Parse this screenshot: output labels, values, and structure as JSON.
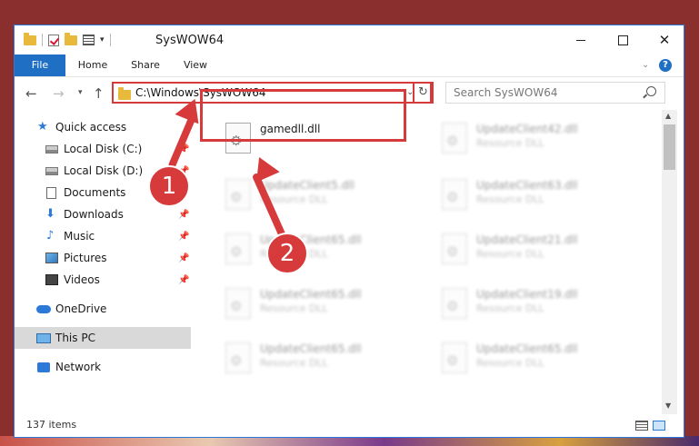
{
  "window": {
    "title": "SysWOW64"
  },
  "ribbon": {
    "tabs": [
      "File",
      "Home",
      "Share",
      "View"
    ]
  },
  "address": {
    "path": "C:\\Windows\\SysWOW64"
  },
  "search": {
    "placeholder": "Search SysWOW64"
  },
  "nav": {
    "items": [
      {
        "label": "Quick access",
        "icon": "star-icon",
        "pinned": false
      },
      {
        "label": "Local Disk (C:)",
        "icon": "drive-icon",
        "pinned": true
      },
      {
        "label": "Local Disk (D:)",
        "icon": "drive-icon",
        "pinned": true
      },
      {
        "label": "Documents",
        "icon": "documents-icon",
        "pinned": true
      },
      {
        "label": "Downloads",
        "icon": "download-icon",
        "pinned": true
      },
      {
        "label": "Music",
        "icon": "music-icon",
        "pinned": true
      },
      {
        "label": "Pictures",
        "icon": "pictures-icon",
        "pinned": true
      },
      {
        "label": "Videos",
        "icon": "videos-icon",
        "pinned": true
      },
      {
        "label": "OneDrive",
        "icon": "cloud-icon",
        "pinned": false
      },
      {
        "label": "This PC",
        "icon": "computer-icon",
        "pinned": false
      },
      {
        "label": "Network",
        "icon": "network-icon",
        "pinned": false
      }
    ]
  },
  "files": [
    {
      "name": "gamedll.dll",
      "type": ""
    },
    {
      "name": "UpdateClient42.dll",
      "type": "Resource DLL"
    },
    {
      "name": "UpdateClient5.dll",
      "type": "Resource DLL"
    },
    {
      "name": "UpdateClient63.dll",
      "type": "Resource DLL"
    },
    {
      "name": "UpdateClient65.dll",
      "type": "Resource DLL"
    },
    {
      "name": "UpdateClient21.dll",
      "type": "Resource DLL"
    },
    {
      "name": "UpdateClient65.dll",
      "type": "Resource DLL"
    },
    {
      "name": "UpdateClient19.dll",
      "type": "Resource DLL"
    },
    {
      "name": "UpdateClient65.dll",
      "type": "Resource DLL"
    },
    {
      "name": "UpdateClient65.dll",
      "type": "Resource DLL"
    }
  ],
  "status": {
    "item_count": "137 items"
  },
  "annotations": {
    "step1": "1",
    "step2": "2",
    "color": "#d73a3a"
  }
}
